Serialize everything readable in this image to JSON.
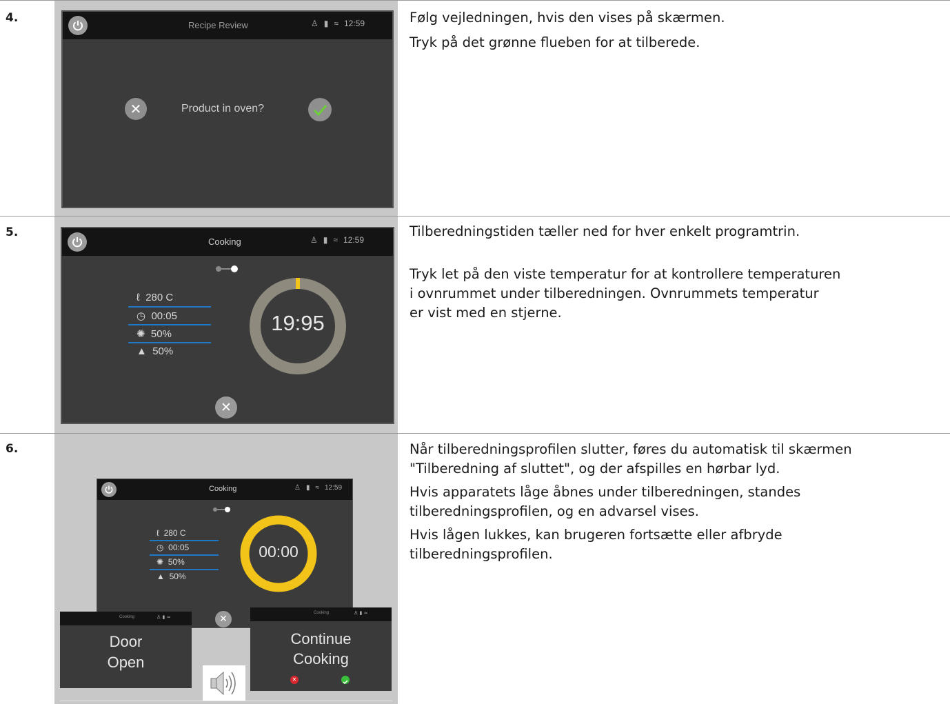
{
  "steps": [
    {
      "number": "4.",
      "screen": {
        "title": "Recipe Review",
        "time": "12:59",
        "question": "Product in oven?"
      },
      "lines": [
        "Følg vejledningen, hvis den vises på skærmen.",
        "Tryk på det grønne flueben for at tilberede."
      ]
    },
    {
      "number": "5.",
      "screen": {
        "title": "Cooking",
        "time": "12:59",
        "temperature": "280 C",
        "duration": "00:05",
        "fan": "50%",
        "humidity": "50%",
        "timer": "19:95"
      },
      "lines": [
        "Tilberedningstiden tæller ned for hver enkelt programtrin.",
        "Tryk let på den viste temperatur for at kontrollere temperaturen",
        "i ovnrummet under tilberedningen. Ovnrummets temperatur",
        "er vist med en stjerne."
      ]
    },
    {
      "number": "6.",
      "screen": {
        "title": "Cooking",
        "time": "12:59",
        "temperature": "280 C",
        "duration": "00:05",
        "fan": "50%",
        "humidity": "50%",
        "timer": "00:00"
      },
      "popup_door": {
        "title": "Cooking",
        "line1": "Door",
        "line2": "Open"
      },
      "popup_continue": {
        "title": "Cooking",
        "line1": "Continue",
        "line2": "Cooking"
      },
      "lines": [
        "Når tilberedningsprofilen slutter, føres du automatisk til skærmen",
        "\"Tilberedning af sluttet\", og der afspilles en hørbar lyd.",
        "Hvis apparatets låge åbnes under tilberedningen, standes",
        "tilberedningsprofilen, og en advarsel vises.",
        "Hvis lågen lukkes, kan brugeren fortsætte eller afbryde",
        "tilberedningsprofilen."
      ]
    }
  ],
  "colors": {
    "accent_green": "#6ccf3a",
    "accent_yellow": "#f2c318",
    "param_line_blue": "#1f78c8",
    "screen_bg": "#3b3b3b"
  },
  "icons": [
    "power-icon",
    "chef-icon",
    "lock-icon",
    "wifi-icon",
    "close-icon",
    "check-icon",
    "thermometer-icon",
    "clock-icon",
    "fan-icon",
    "humidity-icon",
    "speaker-icon"
  ]
}
